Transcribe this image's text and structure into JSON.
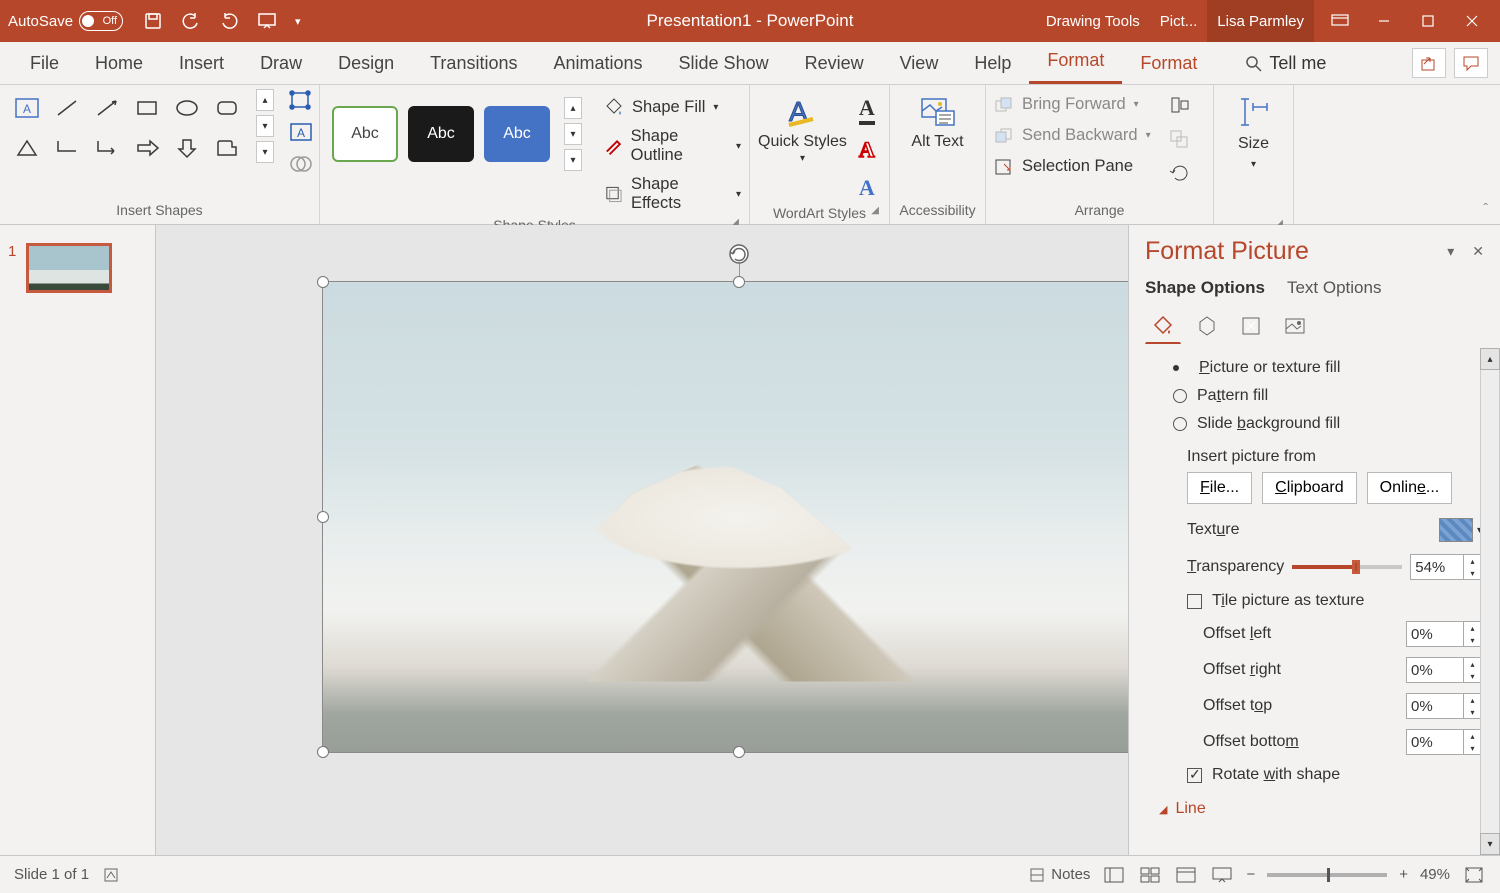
{
  "titlebar": {
    "autosave_label": "AutoSave",
    "autosave_state": "Off",
    "doc_title": "Presentation1  -  PowerPoint",
    "tool_context1": "Drawing Tools",
    "tool_context2": "Pict...",
    "user": "Lisa Parmley"
  },
  "tabs": {
    "items": [
      "File",
      "Home",
      "Insert",
      "Draw",
      "Design",
      "Transitions",
      "Animations",
      "Slide Show",
      "Review",
      "View",
      "Help",
      "Format",
      "Format"
    ],
    "tellme": "Tell me"
  },
  "ribbon": {
    "g_insert": "Insert Shapes",
    "g_styles": "Shape Styles",
    "fill": "Shape Fill",
    "outline": "Shape Outline",
    "effects": "Shape Effects",
    "abc": "Abc",
    "quick": "Quick Styles",
    "g_wordart": "WordArt Styles",
    "alttext": "Alt Text",
    "g_acc": "Accessibility",
    "bring": "Bring Forward",
    "send": "Send Backward",
    "selpane": "Selection Pane",
    "g_arrange": "Arrange",
    "size": "Size"
  },
  "pane": {
    "title": "Format Picture",
    "tab_shape": "Shape Options",
    "tab_text": "Text Options",
    "fill_pic": "Picture or texture fill",
    "fill_pat": "Pattern fill",
    "fill_bg": "Slide background fill",
    "insert_from": "Insert picture from",
    "btn_file": "File...",
    "btn_clip": "Clipboard",
    "btn_online": "Online...",
    "texture": "Texture",
    "transparency": "Transparency",
    "trans_val": "54%",
    "tile": "Tile picture as texture",
    "off_l": "Offset left",
    "off_r": "Offset right",
    "off_t": "Offset top",
    "off_b": "Offset bottom",
    "pct": "0%",
    "rotate": "Rotate with shape",
    "line": "Line"
  },
  "status": {
    "slide": "Slide 1 of 1",
    "notes": "Notes",
    "zoom": "49%"
  },
  "thumb": {
    "num": "1"
  }
}
